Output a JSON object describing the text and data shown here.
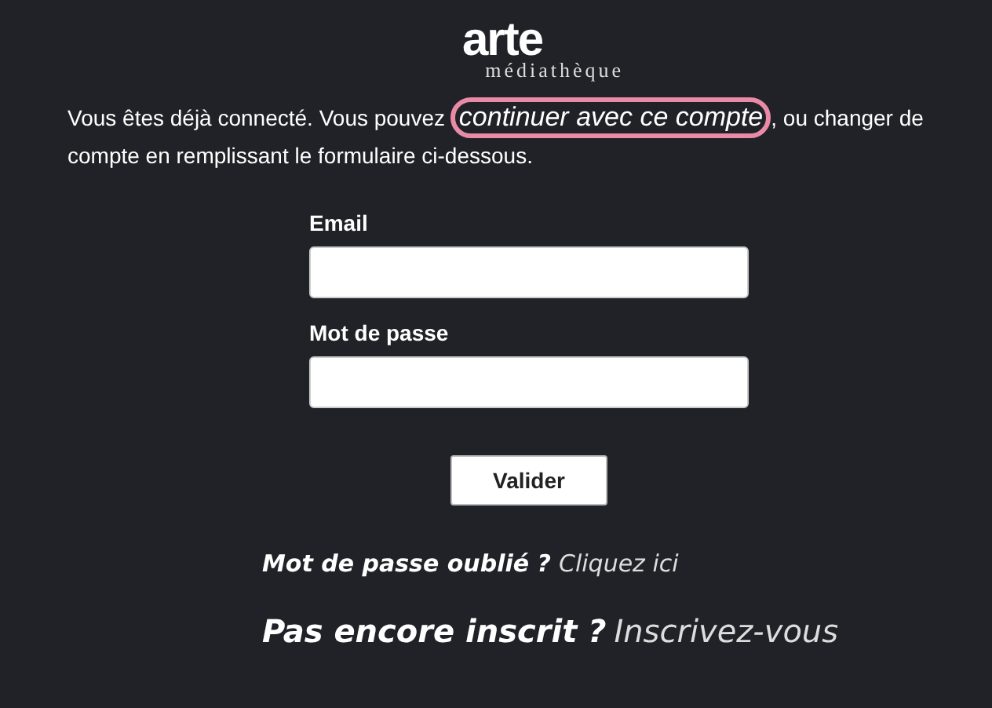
{
  "logo": {
    "brand": "arte",
    "subtitle": "médiathèque"
  },
  "notice": {
    "before": "Vous êtes déjà connecté. Vous pouvez ",
    "link": "continuer avec ce compte",
    "after": ", ou changer de compte en remplissant le formulaire ci-dessous.",
    "highlighted": true
  },
  "fields": [
    {
      "label": "Email"
    },
    {
      "label": "Mot de passe"
    }
  ],
  "submit": "Valider",
  "links": [
    {
      "kind": "small",
      "question": "Mot de passe oublié ?",
      "link": "Cliquez ici"
    },
    {
      "kind": "large",
      "question": "Pas encore inscrit ?",
      "link": "Inscrivez-vous"
    }
  ]
}
